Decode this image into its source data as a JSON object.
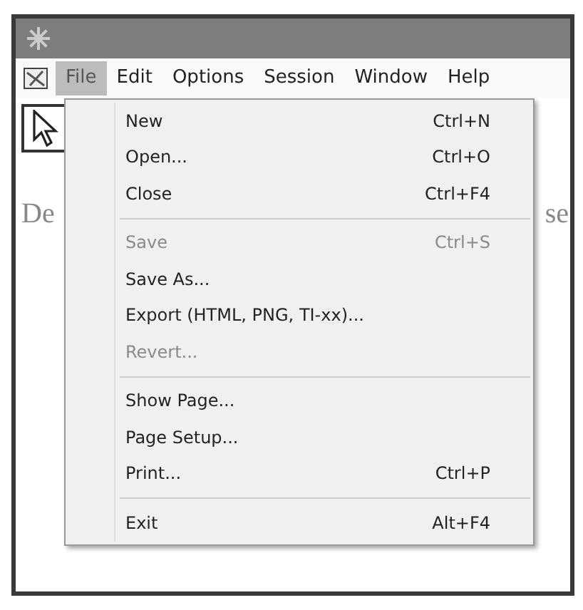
{
  "menu_bar": [
    {
      "label": "File",
      "selected": true
    },
    {
      "label": "Edit",
      "selected": false
    },
    {
      "label": "Options",
      "selected": false
    },
    {
      "label": "Session",
      "selected": false
    },
    {
      "label": "Window",
      "selected": false
    },
    {
      "label": "Help",
      "selected": false
    }
  ],
  "content": {
    "left_text": "De",
    "right_text": "se"
  },
  "file_menu": [
    {
      "kind": "item",
      "label": "New",
      "shortcut": "Ctrl+N",
      "disabled": false
    },
    {
      "kind": "item",
      "label": "Open...",
      "shortcut": "Ctrl+O",
      "disabled": false
    },
    {
      "kind": "item",
      "label": "Close",
      "shortcut": "Ctrl+F4",
      "disabled": false
    },
    {
      "kind": "separator"
    },
    {
      "kind": "item",
      "label": "Save",
      "shortcut": "Ctrl+S",
      "disabled": true
    },
    {
      "kind": "item",
      "label": "Save As...",
      "disabled": false
    },
    {
      "kind": "item",
      "label": "Export (HTML, PNG, TI-xx)...",
      "disabled": false
    },
    {
      "kind": "item",
      "label": "Revert...",
      "disabled": true
    },
    {
      "kind": "separator"
    },
    {
      "kind": "item",
      "label": "Show Page...",
      "disabled": false
    },
    {
      "kind": "item",
      "label": "Page Setup...",
      "disabled": false
    },
    {
      "kind": "item",
      "label": "Print...",
      "shortcut": "Ctrl+P",
      "disabled": false
    },
    {
      "kind": "separator"
    },
    {
      "kind": "item",
      "label": "Exit",
      "shortcut": "Alt+F4",
      "disabled": false
    }
  ]
}
